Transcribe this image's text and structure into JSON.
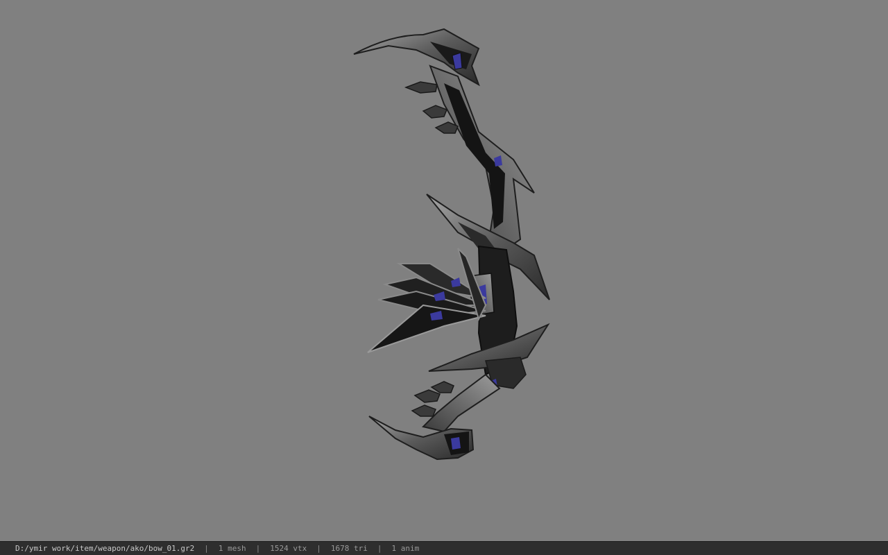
{
  "viewport": {
    "background": "#808080",
    "model_name": "bow_01",
    "accent_gem_color": "#3b3a9e"
  },
  "statusbar": {
    "path": "D:/ymir work/item/weapon/ako/bow_01.gr2",
    "separator": "|",
    "mesh": "1 mesh",
    "vertices": "1524 vtx",
    "triangles": "1678 tri",
    "animations": "1 anim"
  }
}
